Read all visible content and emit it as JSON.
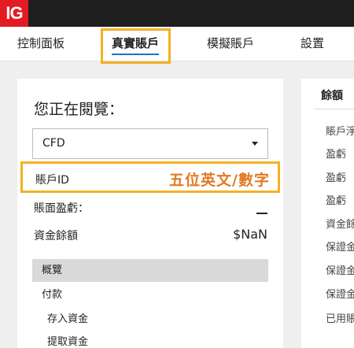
{
  "brand": {
    "logo": "IG",
    "accent": "#e31b23",
    "highlight": "#f3b122",
    "annotation_color": "#e07b23"
  },
  "nav": {
    "items": [
      {
        "label": "控制面板"
      },
      {
        "label": "真實賬戶",
        "active": true
      },
      {
        "label": "模擬賬戶"
      },
      {
        "label": "設置"
      }
    ]
  },
  "account_card": {
    "title": "您正在閱覽：",
    "selector": {
      "value": "CFD"
    },
    "account_id": {
      "label": "賬戶ID",
      "annotation": "五位英文/數字"
    },
    "pnl": {
      "label": "賬面盈虧："
    },
    "balance": {
      "label": "資金餘額",
      "value": "$NaN"
    },
    "menu": {
      "header": "概覽",
      "items": [
        "付款",
        "存入資金",
        "提取資金"
      ]
    }
  },
  "balance_card": {
    "title": "餘額",
    "items": [
      "賬戶淨",
      "盈虧",
      "盈虧",
      "盈虧",
      "資金餘",
      "保證金",
      "保證金",
      "保證金",
      "已用賬"
    ]
  }
}
